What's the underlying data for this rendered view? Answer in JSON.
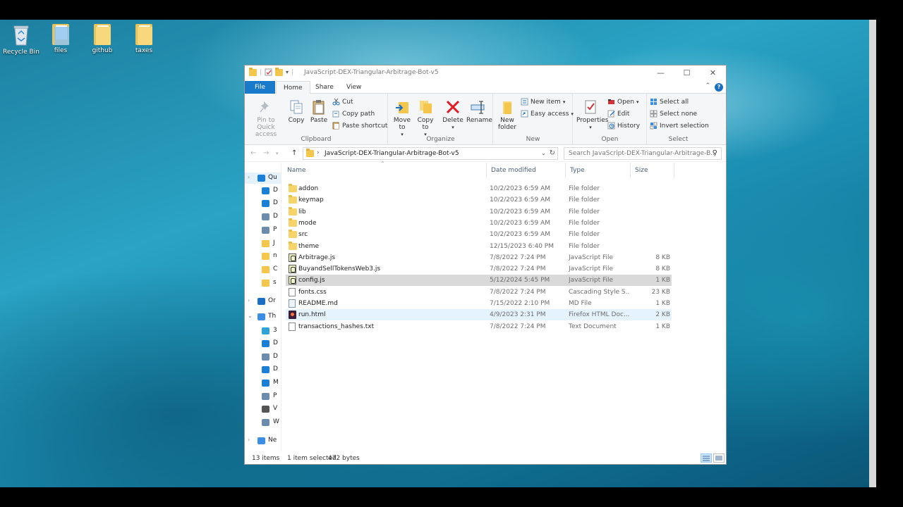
{
  "desktop": {
    "icons": [
      {
        "label": "Recycle Bin",
        "icon": "recycle-bin-icon"
      },
      {
        "label": "files",
        "icon": "folder-icon"
      },
      {
        "label": "github",
        "icon": "folder-icon"
      },
      {
        "label": "taxes",
        "icon": "folder-icon"
      }
    ]
  },
  "window": {
    "title": "JavaScript-DEX-Triangular-Arbitrage-Bot-v5",
    "controls": {
      "minimize": "—",
      "maximize": "☐",
      "close": "✕"
    }
  },
  "ribbon_tabs": {
    "file": "File",
    "home": "Home",
    "share": "Share",
    "view": "View"
  },
  "ribbon": {
    "clipboard": {
      "label": "Clipboard",
      "pin": "Pin to Quick access",
      "copy": "Copy",
      "paste": "Paste",
      "cut": "Cut",
      "copy_path": "Copy path",
      "paste_shortcut": "Paste shortcut"
    },
    "organize": {
      "label": "Organize",
      "move_to": "Move to",
      "copy_to": "Copy to",
      "delete": "Delete",
      "rename": "Rename"
    },
    "new": {
      "label": "New",
      "new_folder": "New folder",
      "new_item": "New item",
      "easy_access": "Easy access"
    },
    "open": {
      "label": "Open",
      "properties": "Properties",
      "open": "Open",
      "edit": "Edit",
      "history": "History"
    },
    "select": {
      "label": "Select",
      "select_all": "Select all",
      "select_none": "Select none",
      "invert_selection": "Invert selection"
    }
  },
  "address": {
    "path": "JavaScript-DEX-Triangular-Arbitrage-Bot-v5",
    "search_placeholder": "Search JavaScript-DEX-Triangular-Arbitrage-B..."
  },
  "nav_pane": [
    {
      "label": "Qu",
      "icon": "star-icon",
      "color": "#1a7fd6"
    },
    {
      "label": "D",
      "icon": "desktop-icon",
      "color": "#1a7fd6"
    },
    {
      "label": "D",
      "icon": "downloads-icon",
      "color": "#1a7fd6"
    },
    {
      "label": "D",
      "icon": "documents-icon",
      "color": "#6b8cad"
    },
    {
      "label": "P",
      "icon": "pictures-icon",
      "color": "#6b8cad"
    },
    {
      "label": "J",
      "icon": "folder-icon",
      "color": "#f4c74c"
    },
    {
      "label": "n",
      "icon": "folder-icon",
      "color": "#f4c74c"
    },
    {
      "label": "C",
      "icon": "folder-icon",
      "color": "#f4c74c"
    },
    {
      "label": "s",
      "icon": "folder-icon",
      "color": "#f4c74c"
    },
    {
      "label": "Or",
      "icon": "onedrive-icon",
      "color": "#1a6fc5"
    },
    {
      "label": "Th",
      "icon": "this-pc-icon",
      "color": "#3a8ee6"
    },
    {
      "label": "3",
      "icon": "3d-objects-icon",
      "color": "#2fa3d8"
    },
    {
      "label": "D",
      "icon": "desktop-icon",
      "color": "#1a7fd6"
    },
    {
      "label": "D",
      "icon": "documents-icon",
      "color": "#6b8cad"
    },
    {
      "label": "D",
      "icon": "downloads-icon",
      "color": "#1a7fd6"
    },
    {
      "label": "M",
      "icon": "music-icon",
      "color": "#1a7fd6"
    },
    {
      "label": "P",
      "icon": "pictures-icon",
      "color": "#6b8cad"
    },
    {
      "label": "V",
      "icon": "videos-icon",
      "color": "#555555"
    },
    {
      "label": "W",
      "icon": "drive-icon",
      "color": "#6b8cad"
    },
    {
      "label": "Ne",
      "icon": "network-icon",
      "color": "#3a8ee6"
    }
  ],
  "columns": {
    "name": "Name",
    "date": "Date modified",
    "type": "Type",
    "size": "Size"
  },
  "files": [
    {
      "name": "addon",
      "date": "10/2/2023 6:59 AM",
      "type": "File folder",
      "size": "",
      "kind": "folder"
    },
    {
      "name": "keymap",
      "date": "10/2/2023 6:59 AM",
      "type": "File folder",
      "size": "",
      "kind": "folder"
    },
    {
      "name": "lib",
      "date": "10/2/2023 6:59 AM",
      "type": "File folder",
      "size": "",
      "kind": "folder"
    },
    {
      "name": "mode",
      "date": "10/2/2023 6:59 AM",
      "type": "File folder",
      "size": "",
      "kind": "folder"
    },
    {
      "name": "src",
      "date": "10/2/2023 6:59 AM",
      "type": "File folder",
      "size": "",
      "kind": "folder"
    },
    {
      "name": "theme",
      "date": "12/15/2023 6:40 PM",
      "type": "File folder",
      "size": "",
      "kind": "folder"
    },
    {
      "name": "Arbitrage.js",
      "date": "7/8/2022 7:24 PM",
      "type": "JavaScript File",
      "size": "8 KB",
      "kind": "js"
    },
    {
      "name": "BuyandSellTokensWeb3.js",
      "date": "7/8/2022 7:24 PM",
      "type": "JavaScript File",
      "size": "8 KB",
      "kind": "js"
    },
    {
      "name": "config.js",
      "date": "5/12/2024 5:45 PM",
      "type": "JavaScript File",
      "size": "1 KB",
      "kind": "js",
      "state": "selected"
    },
    {
      "name": "fonts.css",
      "date": "7/8/2022 7:24 PM",
      "type": "Cascading Style S...",
      "size": "23 KB",
      "kind": "doc"
    },
    {
      "name": "README.md",
      "date": "7/15/2022 2:10 PM",
      "type": "MD File",
      "size": "1 KB",
      "kind": "md"
    },
    {
      "name": "run.html",
      "date": "4/9/2023 2:31 PM",
      "type": "Firefox HTML Doc...",
      "size": "2 KB",
      "kind": "html",
      "state": "hover"
    },
    {
      "name": "transactions_hashes.txt",
      "date": "7/8/2022 7:24 PM",
      "type": "Text Document",
      "size": "1 KB",
      "kind": "doc"
    }
  ],
  "status": {
    "count": "13 items",
    "selection": "1 item selected",
    "bytes": "472 bytes"
  }
}
